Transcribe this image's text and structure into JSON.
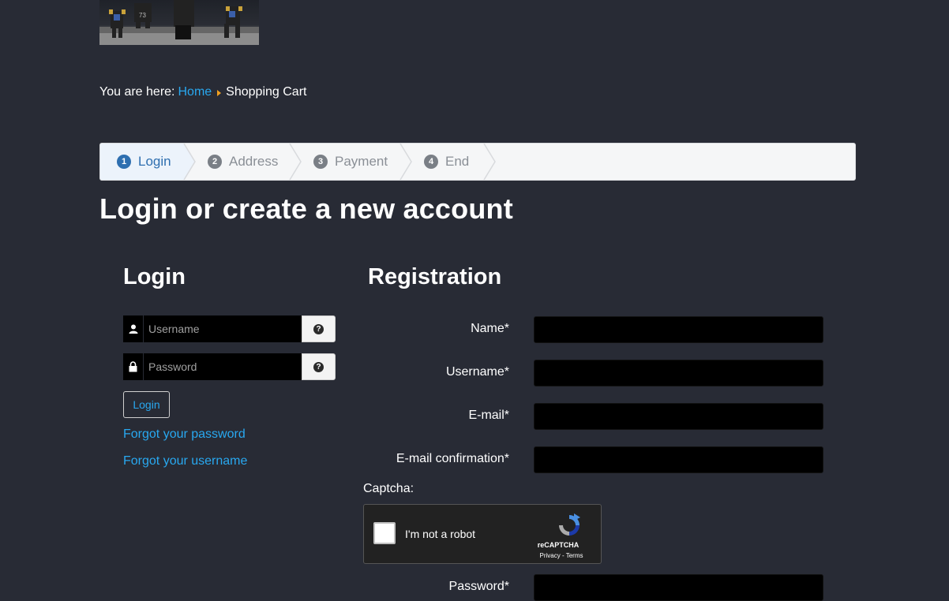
{
  "breadcrumb": {
    "prefix": "You are here:",
    "home": "Home",
    "current": "Shopping Cart"
  },
  "steps": [
    {
      "num": "1",
      "label": "Login",
      "active": true
    },
    {
      "num": "2",
      "label": "Address",
      "active": false
    },
    {
      "num": "3",
      "label": "Payment",
      "active": false
    },
    {
      "num": "4",
      "label": "End",
      "active": false
    }
  ],
  "page_title": "Login or create a new account",
  "login": {
    "heading": "Login",
    "username_placeholder": "Username",
    "password_placeholder": "Password",
    "help_icon": "question-circle-icon",
    "button": "Login",
    "forgot_password": "Forgot your password",
    "forgot_username": "Forgot your username"
  },
  "registration": {
    "heading": "Registration",
    "fields": [
      {
        "label": "Name*",
        "value": ""
      },
      {
        "label": "Username*",
        "value": ""
      },
      {
        "label": "E-mail*",
        "value": ""
      },
      {
        "label": "E-mail confirmation*",
        "value": ""
      }
    ],
    "captcha_label": "Captcha:",
    "password_label": "Password*"
  },
  "recaptcha": {
    "checkbox_text": "I'm not a robot",
    "brand": "reCAPTCHA",
    "terms": "Privacy - Terms"
  },
  "colors": {
    "background": "#282b35",
    "link": "#28a8f0",
    "step_active": "#2e6fb0",
    "breadcrumb_arrow": "#f0a020"
  }
}
